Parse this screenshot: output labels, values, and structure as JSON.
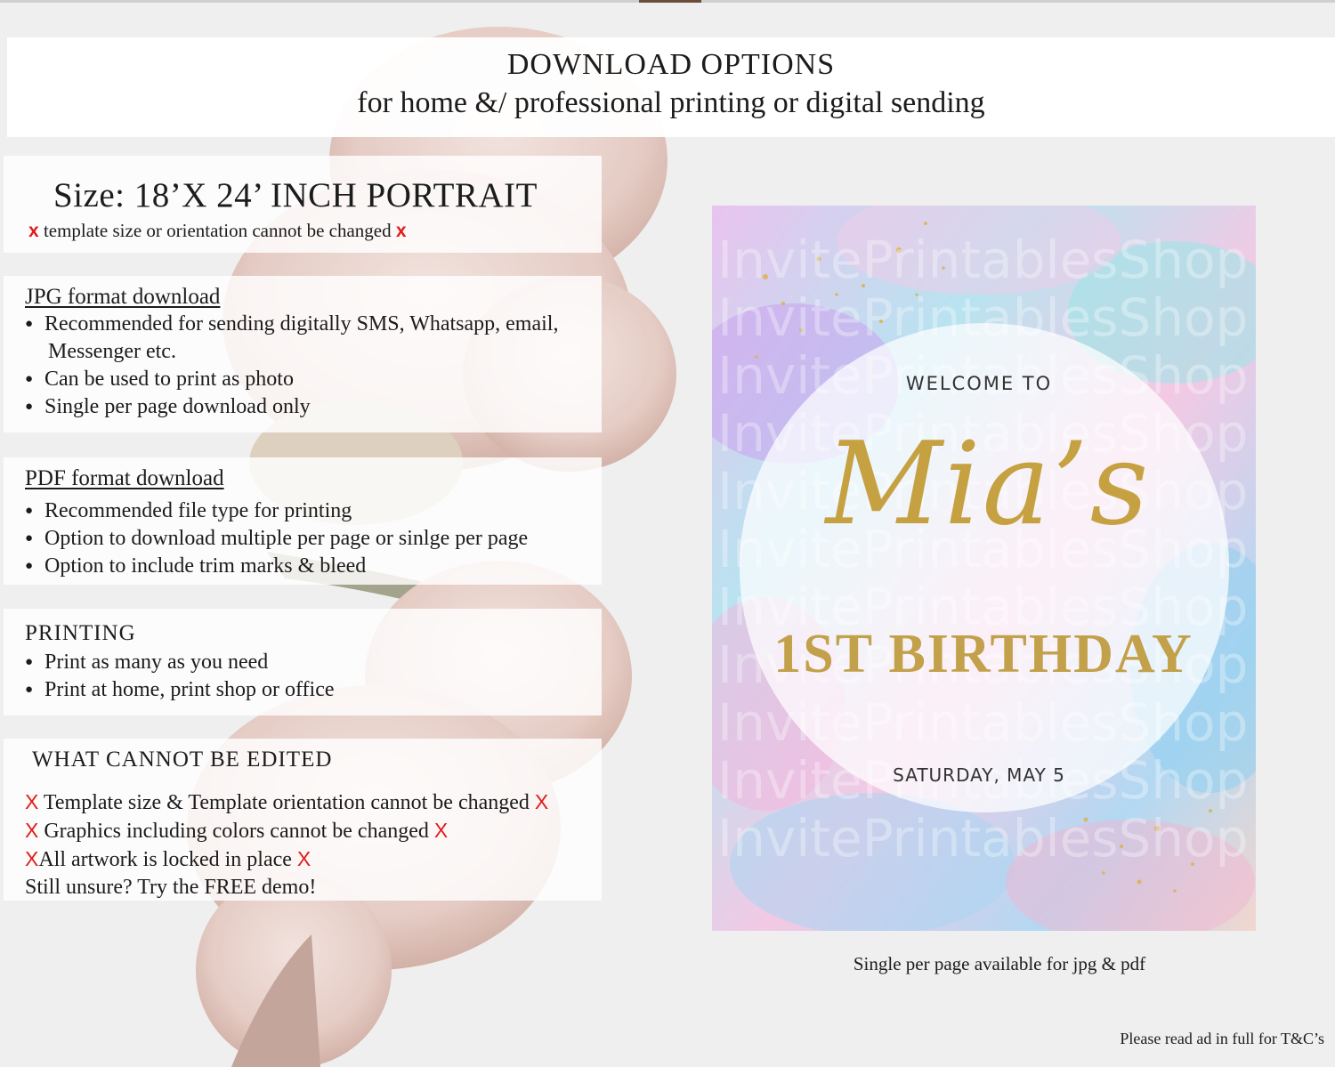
{
  "header": {
    "title": "DOWNLOAD OPTIONS",
    "subtitle": "for home &/ professional printing or digital sending"
  },
  "size": {
    "title": "Size: 18’X 24’ INCH PORTRAIT",
    "note_mark": "x",
    "note": "template size or orientation cannot be changed"
  },
  "jpg": {
    "title": "JPG format download",
    "items": [
      "Recommended for sending digitally SMS, Whatsapp, email,",
      "Messenger etc.",
      "Can be used to print as photo",
      "Single per page download only"
    ]
  },
  "pdf": {
    "title": "PDF format download",
    "items": [
      "Recommended file type for printing",
      "Option to download multiple per page or sinlge per page",
      "Option to include trim marks & bleed"
    ]
  },
  "printing": {
    "title": "PRINTING",
    "items": [
      "Print as many as you need",
      "Print at home, print shop or office"
    ]
  },
  "edit": {
    "title": "WHAT CANNOT BE EDITED",
    "mark": "X",
    "lines": [
      "Template size & Template orientation cannot be changed",
      "Graphics including colors cannot be changed",
      "All artwork is locked in place"
    ],
    "closing": "Still unsure? Try the FREE demo!"
  },
  "poster": {
    "welcome": "WELCOME TO",
    "name": "Mia’s",
    "event": "1ST BIRTHDAY",
    "date": "SATURDAY, MAY 5",
    "watermark": "InvitePrintablesShop"
  },
  "caption": "Single per page available for jpg & pdf",
  "footnote": "Please read ad in full for T&C’s",
  "colors": {
    "red_mark": "#e31b1b",
    "gold": "#c6a142",
    "background": "#efefef"
  }
}
